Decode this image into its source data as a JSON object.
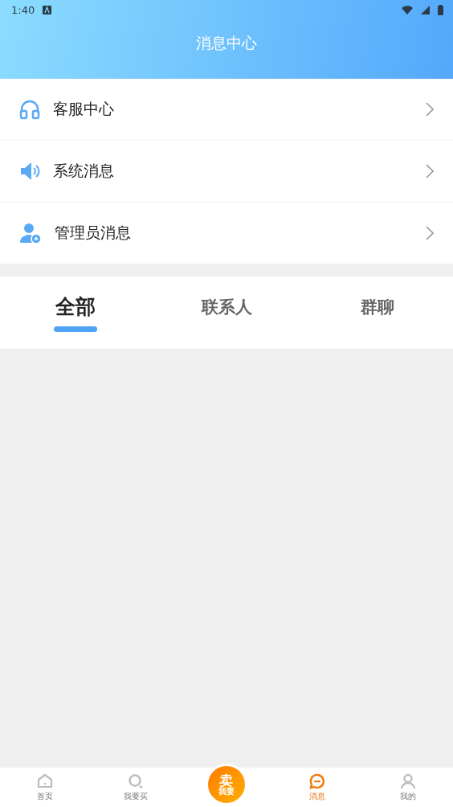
{
  "status_bar": {
    "time": "1:40"
  },
  "header": {
    "title": "消息中心"
  },
  "menu": [
    {
      "label": "客服中心",
      "kind": "headset"
    },
    {
      "label": "系统消息",
      "kind": "speaker"
    },
    {
      "label": "管理员消息",
      "kind": "admin"
    }
  ],
  "tabs": [
    {
      "label": "全部",
      "selected": true
    },
    {
      "label": "联系人",
      "selected": false
    },
    {
      "label": "群聊",
      "selected": false
    }
  ],
  "bottom_nav": [
    {
      "label": "首页",
      "kind": "home",
      "selected": false
    },
    {
      "label": "我要买",
      "kind": "search",
      "selected": false
    },
    {
      "label": "我要",
      "badge": "卖",
      "kind": "center",
      "selected": false
    },
    {
      "label": "消息",
      "kind": "message",
      "selected": true
    },
    {
      "label": "我的",
      "kind": "user",
      "selected": false
    }
  ]
}
